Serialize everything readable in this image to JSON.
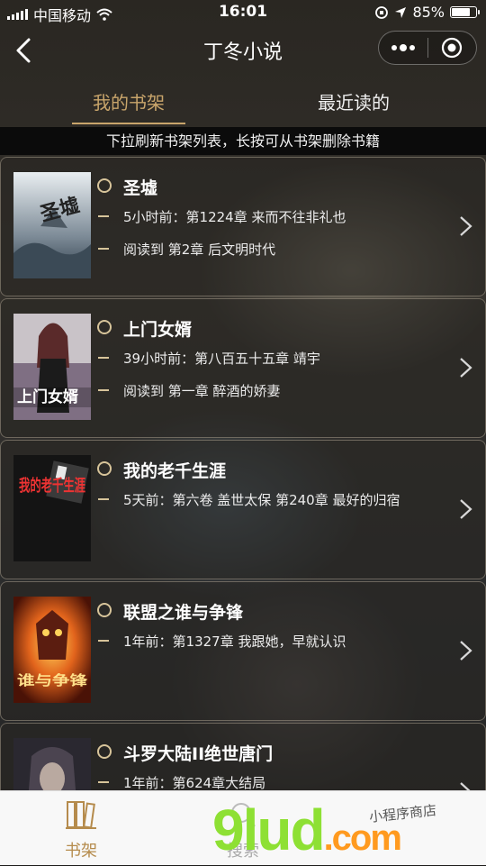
{
  "status_bar": {
    "carrier": "中国移动",
    "time": "16:01",
    "battery": "85%",
    "battery_level": 0.85
  },
  "navbar": {
    "title": "丁冬小说"
  },
  "tabs": {
    "active": "我的书架",
    "recent": "最近读的"
  },
  "tip": "下拉刷新书架列表，长按可从书架删除书籍",
  "books": [
    {
      "title": "圣墟",
      "update": "5小时前：第1224章 来而不往非礼也",
      "progress": "阅读到 第2章 后文明时代",
      "cover_text": "圣墟"
    },
    {
      "title": "上门女婿",
      "update": "39小时前：第八百五十五章 靖宇",
      "progress": "阅读到 第一章 醉酒的娇妻",
      "cover_text": "上门女婿"
    },
    {
      "title": "我的老千生涯",
      "update": "5天前：第六卷 盖世太保 第240章 最好的归宿",
      "cover_text": "我的老千生涯"
    },
    {
      "title": "联盟之谁与争锋",
      "update": "1年前：第1327章 我跟她，早就认识",
      "cover_text": "谁与争锋"
    },
    {
      "title": "斗罗大陆II绝世唐门",
      "update": "1年前：第624章大结局"
    }
  ],
  "tabbar": {
    "bookshelf": "书架",
    "search": "搜索"
  },
  "watermark": {
    "brand": "9lud",
    "tld": ".com",
    "note": "小程序商店"
  },
  "colors": {
    "accent": "#c9a56b",
    "active_tab_text": "#c9a56b",
    "watermark_green": "#8ee034",
    "watermark_orange": "#ff9a1f"
  }
}
